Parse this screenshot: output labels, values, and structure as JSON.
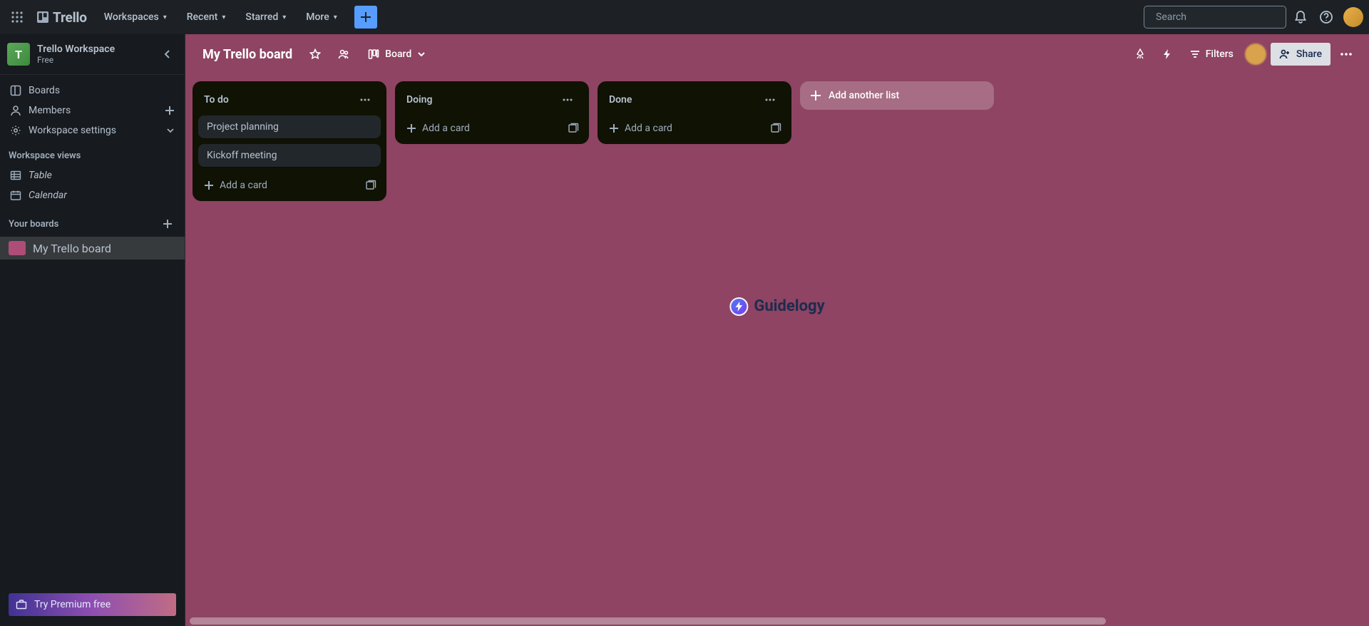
{
  "topnav": {
    "logo_text": "Trello",
    "menus": {
      "workspaces": "Workspaces",
      "recent": "Recent",
      "starred": "Starred",
      "more": "More"
    },
    "search_placeholder": "Search"
  },
  "sidebar": {
    "workspace_initial": "T",
    "workspace_name": "Trello Workspace",
    "workspace_plan": "Free",
    "items": {
      "boards": "Boards",
      "members": "Members",
      "settings": "Workspace settings"
    },
    "views_heading": "Workspace views",
    "views": {
      "table": "Table",
      "calendar": "Calendar"
    },
    "your_boards_heading": "Your boards",
    "boards": [
      {
        "name": "My Trello board"
      }
    ],
    "premium_cta": "Try Premium free"
  },
  "board": {
    "title": "My Trello board",
    "view_label": "Board",
    "filters_label": "Filters",
    "share_label": "Share",
    "add_list_label": "Add another list",
    "add_card_label": "Add a card",
    "lists": [
      {
        "title": "To do",
        "cards": [
          "Project planning",
          "Kickoff meeting"
        ]
      },
      {
        "title": "Doing",
        "cards": []
      },
      {
        "title": "Done",
        "cards": []
      }
    ]
  },
  "watermark": {
    "text": "Guidelogy"
  }
}
